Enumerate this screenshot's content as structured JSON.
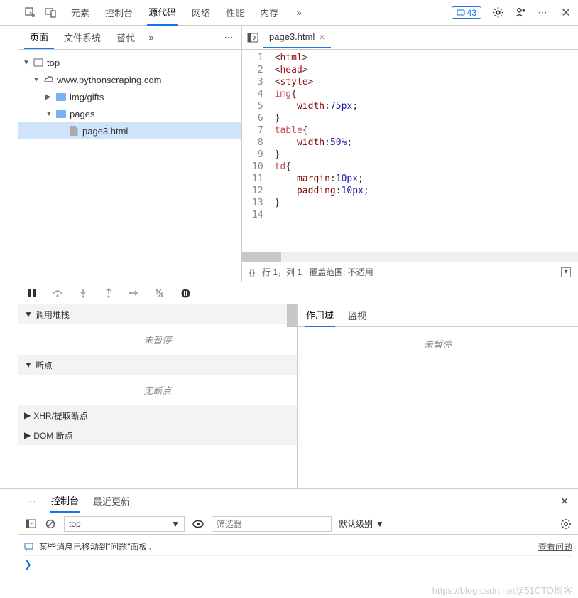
{
  "toolbar": {
    "tabs": [
      "元素",
      "控制台",
      "源代码",
      "网络",
      "性能",
      "内存"
    ],
    "active_tab": "源代码",
    "messages_count": "43"
  },
  "sidebar": {
    "tabs": [
      "页面",
      "文件系统",
      "替代"
    ],
    "active_tab": "页面",
    "tree": {
      "top": "top",
      "domain": "www.pythonscraping.com",
      "folder1": "img/gifts",
      "folder2": "pages",
      "file": "page3.html"
    }
  },
  "editor": {
    "filename": "page3.html",
    "lines": [
      {
        "n": "1",
        "html": "<span class='c-punc'>&lt;</span><span class='c-tag'>html</span><span class='c-punc'>&gt;</span>"
      },
      {
        "n": "2",
        "html": "<span class='c-punc'>&lt;</span><span class='c-tag'>head</span><span class='c-punc'>&gt;</span>"
      },
      {
        "n": "3",
        "html": "<span class='c-punc'>&lt;</span><span class='c-tag'>style</span><span class='c-punc'>&gt;</span>"
      },
      {
        "n": "4",
        "html": "<span class='c-sel'>img</span><span class='c-punc'>{</span>"
      },
      {
        "n": "5",
        "html": "    <span class='c-prop'>width</span><span class='c-punc'>:</span><span class='c-num'>75px</span><span class='c-punc'>;</span>"
      },
      {
        "n": "6",
        "html": "<span class='c-punc'>}</span>"
      },
      {
        "n": "7",
        "html": "<span class='c-sel'>table</span><span class='c-punc'>{</span>"
      },
      {
        "n": "8",
        "html": "    <span class='c-prop'>width</span><span class='c-punc'>:</span><span class='c-num'>50%</span><span class='c-punc'>;</span>"
      },
      {
        "n": "9",
        "html": "<span class='c-punc'>}</span>"
      },
      {
        "n": "10",
        "html": "<span class='c-sel'>td</span><span class='c-punc'>{</span>"
      },
      {
        "n": "11",
        "html": "    <span class='c-prop'>margin</span><span class='c-punc'>:</span><span class='c-num'>10px</span><span class='c-punc'>;</span>"
      },
      {
        "n": "12",
        "html": "    <span class='c-prop'>padding</span><span class='c-punc'>:</span><span class='c-num'>10px</span><span class='c-punc'>;</span>"
      },
      {
        "n": "13",
        "html": "<span class='c-punc'>}</span>"
      },
      {
        "n": "14",
        "html": ""
      }
    ],
    "status": {
      "braces": "{}",
      "position": "行 1，列 1",
      "coverage": "覆盖范围: 不适用"
    }
  },
  "debugger": {
    "sections": {
      "callstack": "调用堆栈",
      "callstack_body": "未暂停",
      "breakpoints": "断点",
      "breakpoints_body": "无断点",
      "xhr": "XHR/提取断点",
      "dom": "DOM 断点"
    },
    "scope_tabs": [
      "作用域",
      "监视"
    ],
    "scope_active": "作用域",
    "scope_body": "未暂停"
  },
  "console": {
    "tabs": [
      "控制台",
      "最近更新"
    ],
    "active_tab": "控制台",
    "context": "top",
    "filter_placeholder": "筛选器",
    "level": "默认级别",
    "message": "某些消息已移动到\"问题\"面板。",
    "link": "查看问题",
    "settings_icon": "gear-icon"
  },
  "watermark": "https://blog.csdn.net@51CTO博客"
}
